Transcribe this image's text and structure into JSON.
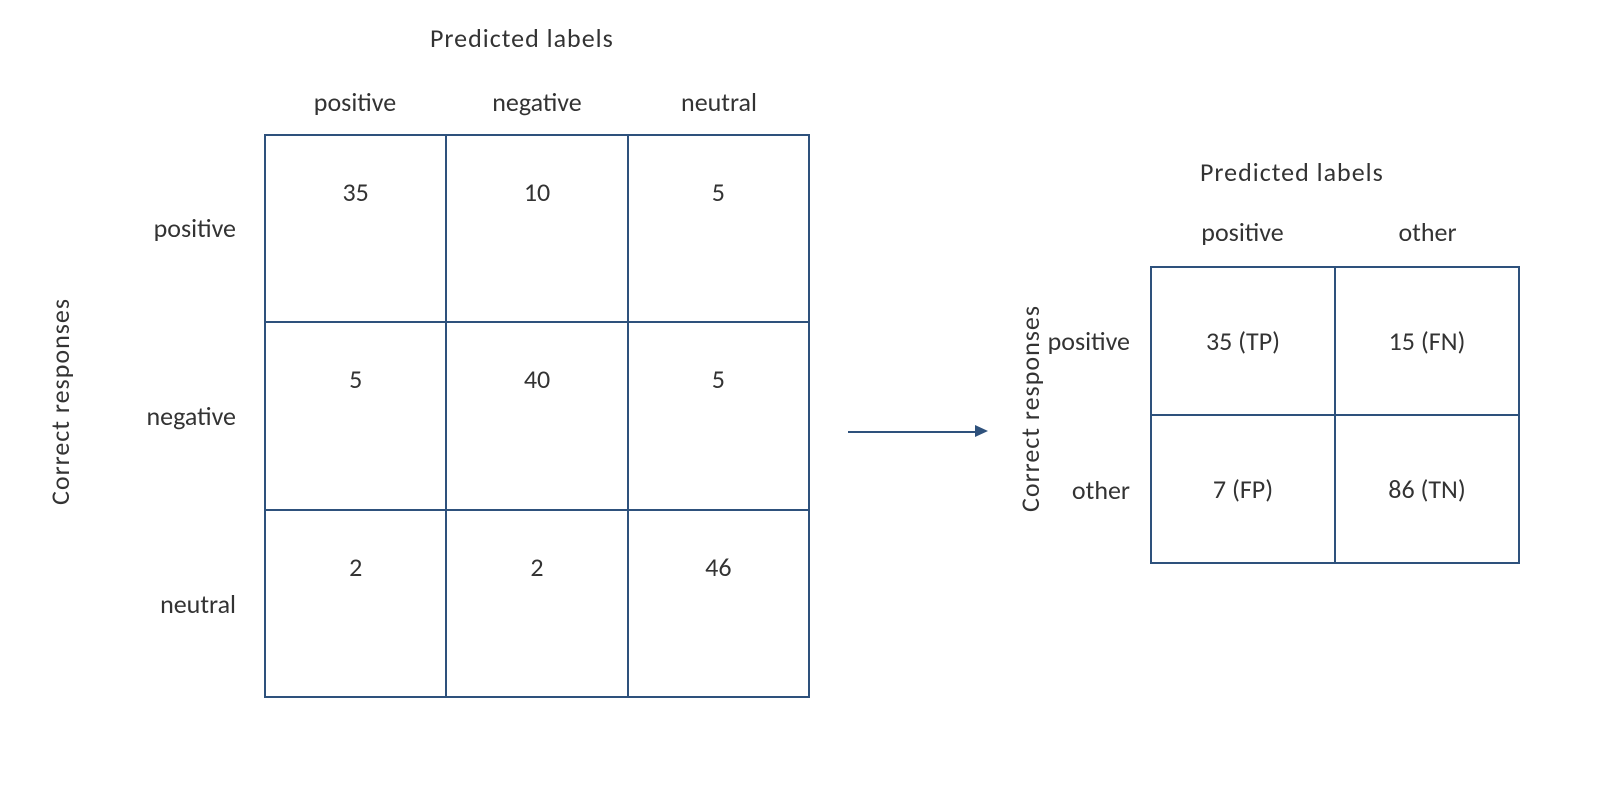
{
  "left": {
    "top_title": "Predicted  labels",
    "side_title": "Correct  responses",
    "col_labels": [
      "positive",
      "negative",
      "neutral"
    ],
    "row_labels": [
      "positive",
      "negative",
      "neutral"
    ],
    "cells": [
      [
        "35",
        "10",
        "5"
      ],
      [
        "5",
        "40",
        "5"
      ],
      [
        "2",
        "2",
        "46"
      ]
    ]
  },
  "right": {
    "top_title": "Predicted  labels",
    "side_title": "Correct  responses",
    "col_labels": [
      "positive",
      "other"
    ],
    "row_labels": [
      "positive",
      "other"
    ],
    "cells": [
      [
        "35 (TP)",
        "15 (FN)"
      ],
      [
        "7 (FP)",
        "86 (TN)"
      ]
    ]
  },
  "chart_data": {
    "type": "table",
    "description": "Two confusion matrices. Left is 3x3 multiclass (positive/negative/neutral). Right is its 2x2 reduction vs 'positive' with TP/FN/FP/TN annotations.",
    "left_matrix": {
      "axis_x": "Predicted labels",
      "axis_y": "Correct responses",
      "classes": [
        "positive",
        "negative",
        "neutral"
      ],
      "values": [
        [
          35,
          10,
          5
        ],
        [
          5,
          40,
          5
        ],
        [
          2,
          2,
          46
        ]
      ]
    },
    "right_matrix": {
      "axis_x": "Predicted labels",
      "axis_y": "Correct responses",
      "classes": [
        "positive",
        "other"
      ],
      "values": [
        [
          35,
          15
        ],
        [
          7,
          86
        ]
      ],
      "annotations": [
        [
          "TP",
          "FN"
        ],
        [
          "FP",
          "TN"
        ]
      ]
    }
  }
}
